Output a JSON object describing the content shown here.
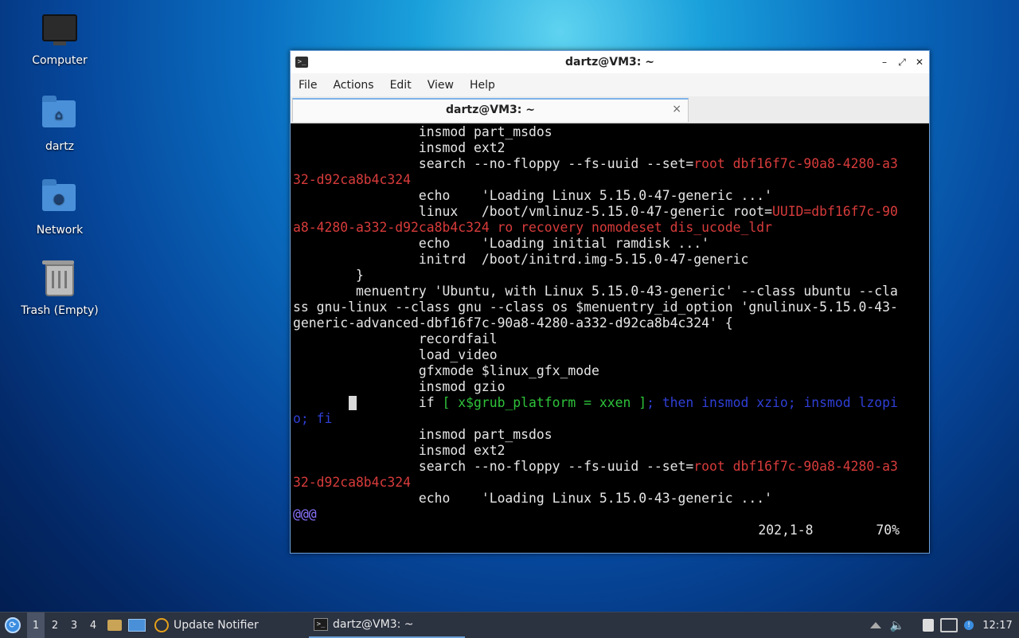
{
  "desktop": {
    "icons": [
      {
        "label": "Computer",
        "icon": "computer-icon"
      },
      {
        "label": "dartz",
        "icon": "home-folder-icon"
      },
      {
        "label": "Network",
        "icon": "network-folder-icon"
      },
      {
        "label": "Trash (Empty)",
        "icon": "trash-icon"
      }
    ]
  },
  "window": {
    "title": "dartz@VM3: ~",
    "controls": {
      "minimize": "–",
      "maximize": "⤢",
      "close": "✕"
    },
    "menu": [
      "File",
      "Actions",
      "Edit",
      "View",
      "Help"
    ],
    "tab": {
      "title": "dartz@VM3: ~",
      "close": "×"
    }
  },
  "terminal": {
    "lines": [
      [
        {
          "t": "                insmod part_msdos",
          "c": ""
        }
      ],
      [
        {
          "t": "                insmod ext2",
          "c": ""
        }
      ],
      [
        {
          "t": "                search --no-floppy --fs-uuid --set=",
          "c": ""
        },
        {
          "t": "root dbf16f7c-90a8-4280-a3",
          "c": "red"
        }
      ],
      [
        {
          "t": "32-d92ca8b4c324",
          "c": "red"
        }
      ],
      [
        {
          "t": "                echo    'Loading Linux 5.15.0-47-generic ...'",
          "c": ""
        }
      ],
      [
        {
          "t": "                linux   /boot/vmlinuz-5.15.0-47-generic root=",
          "c": ""
        },
        {
          "t": "UUID=dbf16f7c-90",
          "c": "red"
        }
      ],
      [
        {
          "t": "a8-4280-a332-d92ca8b4c324 ro recovery nomodeset dis_ucode_ldr",
          "c": "red"
        }
      ],
      [
        {
          "t": "                echo    'Loading initial ramdisk ...'",
          "c": ""
        }
      ],
      [
        {
          "t": "                initrd  /boot/initrd.img-5.15.0-47-generic",
          "c": ""
        }
      ],
      [
        {
          "t": "        }",
          "c": ""
        }
      ],
      [
        {
          "t": "        menuentry 'Ubuntu, with Linux 5.15.0-43-generic' --class ubuntu --cla",
          "c": ""
        }
      ],
      [
        {
          "t": "ss gnu-linux --class gnu --class os $menuentry_id_option 'gnulinux-5.15.0-43-",
          "c": ""
        }
      ],
      [
        {
          "t": "generic-advanced-dbf16f7c-90a8-4280-a332-d92ca8b4c324' {",
          "c": ""
        }
      ],
      [
        {
          "t": "                recordfail",
          "c": ""
        }
      ],
      [
        {
          "t": "                load_video",
          "c": ""
        }
      ],
      [
        {
          "t": "                gfxmode $linux_gfx_mode",
          "c": ""
        }
      ],
      [
        {
          "t": "                insmod gzio",
          "c": ""
        }
      ],
      [
        {
          "t": "                if ",
          "c": ""
        },
        {
          "t": "[ x$grub_platform = xxen ]",
          "c": "green"
        },
        {
          "t": "; then insmod xzio; insmod lzopi",
          "c": "blue"
        }
      ],
      [
        {
          "t": "o; fi",
          "c": "blue"
        }
      ],
      [
        {
          "t": "                insmod part_msdos",
          "c": ""
        }
      ],
      [
        {
          "t": "                insmod ext2",
          "c": ""
        }
      ],
      [
        {
          "t": "                search --no-floppy --fs-uuid --set=",
          "c": ""
        },
        {
          "t": "root dbf16f7c-90a8-4280-a3",
          "c": "red"
        }
      ],
      [
        {
          "t": "32-d92ca8b4c324",
          "c": "red"
        }
      ],
      [
        {
          "t": "                echo    'Loading Linux 5.15.0-43-generic ...'",
          "c": ""
        }
      ],
      [
        {
          "t": "@@@",
          "c": "purple"
        }
      ]
    ],
    "status": "202,1-8        70%"
  },
  "taskbar": {
    "workspaces": [
      "1",
      "2",
      "3",
      "4"
    ],
    "active_workspace": "1",
    "update_notifier": "Update Notifier",
    "task_title": "dartz@VM3: ~",
    "clock": "12:17"
  },
  "colors": {
    "accent": "#6b9ed6",
    "taskbar": "#2b3240",
    "term_red": "#d83b3b",
    "term_green": "#2ec23a",
    "term_blue": "#2f3fd6",
    "term_purple": "#8a73ff"
  }
}
